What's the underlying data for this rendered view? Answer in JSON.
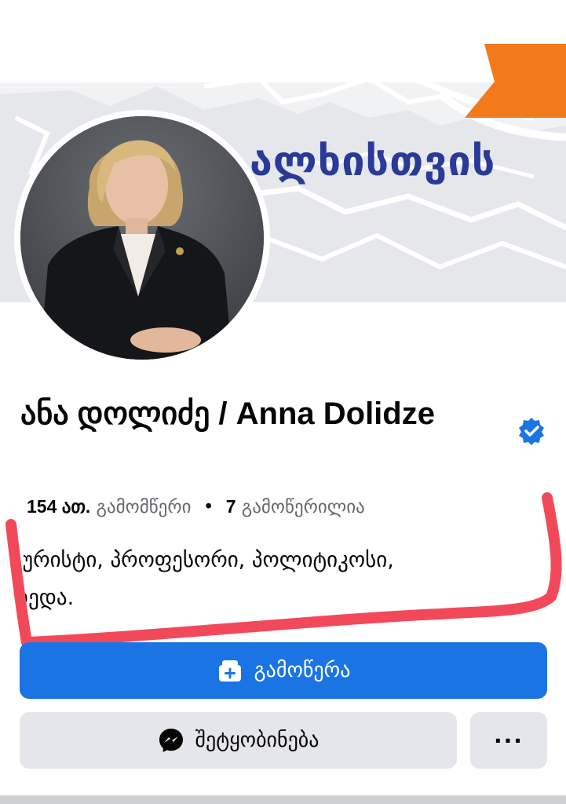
{
  "cover": {
    "text": "ალხისთვის",
    "accent_color": "#f27a1a",
    "text_color": "#2a3a98"
  },
  "profile": {
    "name": "ანა დოლიძე / Anna Dolidze",
    "verified_icon": "verified-badge-icon",
    "followers_count": "154 ათ.",
    "followers_label": "გამომწერი",
    "separator": "•",
    "following_count": "7",
    "following_label": "გამოწერილია",
    "bio_line1": "იურისტი, პროფესორი, პოლიტიკოსი,",
    "bio_line2": "დედა."
  },
  "actions": {
    "follow_label": "გამოწერა",
    "follow_icon": "follow-add-icon",
    "message_label": "შეტყობინება",
    "message_icon": "messenger-icon",
    "more_label": "···"
  },
  "colors": {
    "primary": "#1b74e4",
    "secondary_bg": "#e4e6eb",
    "annotation": "#f2495a"
  }
}
